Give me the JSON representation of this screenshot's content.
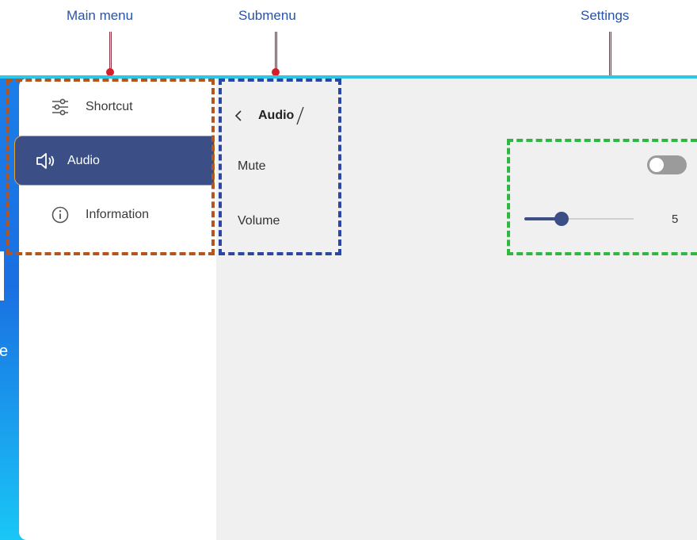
{
  "callouts": {
    "main_menu": "Main menu",
    "submenu": "Submenu",
    "settings": "Settings"
  },
  "main_menu": {
    "items": [
      {
        "label": "Shortcut",
        "icon": "sliders-icon",
        "active": false
      },
      {
        "label": "Audio",
        "icon": "speaker-icon",
        "active": true
      },
      {
        "label": "Information",
        "icon": "info-icon",
        "active": false
      }
    ]
  },
  "submenu": {
    "title": "Audio",
    "rows": [
      "Mute",
      "Volume"
    ]
  },
  "settings": {
    "mute_on": false,
    "volume": 5,
    "volume_fraction": 0.34
  },
  "screen_edge_text": "e",
  "colors": {
    "accent": "#3b4e86",
    "main_box": "#b5541c",
    "submenu_box": "#2c46a6",
    "settings_box": "#2fb841",
    "label": "#2a52a8",
    "pin": "#d41f2b"
  }
}
